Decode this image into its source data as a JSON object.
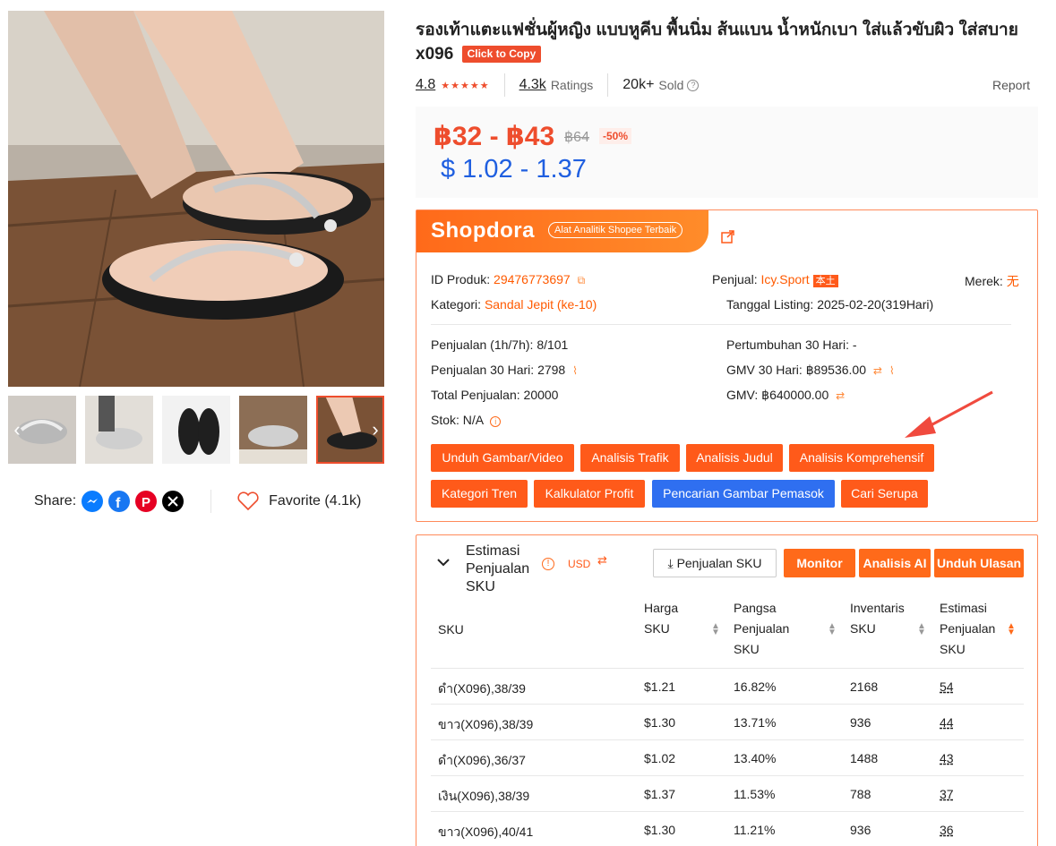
{
  "gallery": {
    "share_label": "Share:",
    "favorite_label": "Favorite (4.1k)",
    "thumbnail_count": 5,
    "active_thumbnail": 5
  },
  "product": {
    "title": "รองเท้าแตะแฟชั่นผู้หญิง แบบหูคีบ พื้นนิ่ม ส้นแบน น้ำหนักเบา ใส่แล้วขับผิว ใส่สบาย x096",
    "copy_label": "Click to Copy",
    "rating": "4.8",
    "rating_stars": 5,
    "ratings_count": "4.3k",
    "ratings_label": "Ratings",
    "sold_count": "20k+",
    "sold_label": "Sold",
    "report_label": "Report"
  },
  "price": {
    "range": "฿32 - ฿43",
    "original": "฿64",
    "discount": "-50%",
    "usd_range": "$ 1.02 - 1.37"
  },
  "shopdora": {
    "brand": "Shopdora",
    "tagline": "Alat Analitik Shopee Terbaik",
    "product_id_label": "ID Produk:",
    "product_id": "29476773697",
    "seller_label": "Penjual:",
    "seller": "Icy.Sport",
    "seller_badge": "本土",
    "brand_label": "Merek:",
    "brand_value": "无",
    "category_label": "Kategori:",
    "category": "Sandal Jepit (ke-10)",
    "listing_label": "Tanggal Listing:",
    "listing_value": "2025-02-20(319Hari)",
    "sales_1h7h_label": "Penjualan (1h/7h):",
    "sales_1h7h": "8/101",
    "growth_label": "Pertumbuhan 30 Hari:",
    "growth": "-",
    "sales_30d_label": "Penjualan 30 Hari:",
    "sales_30d": "2798",
    "gmv_30d_label": "GMV 30 Hari:",
    "gmv_30d": "฿89536.00",
    "total_sales_label": "Total Penjualan:",
    "total_sales": "20000",
    "gmv_label": "GMV:",
    "gmv": "฿640000.00",
    "stock_label": "Stok:",
    "stock": "N/A",
    "buttons": [
      "Unduh Gambar/Video",
      "Analisis Trafik",
      "Analisis Judul",
      "Analisis Komprehensif",
      "Kategori Tren",
      "Kalkulator Profit",
      "Pencarian Gambar Pemasok",
      "Cari Serupa"
    ]
  },
  "sku": {
    "title": "Estimasi Penjualan SKU",
    "currency": "USD",
    "download_label": "Penjualan SKU",
    "monitor_label": "Monitor",
    "ai_label": "Analisis AI",
    "reviews_label": "Unduh Ulasan",
    "headers": [
      "SKU",
      "Harga SKU",
      "Pangsa Penjualan SKU",
      "Inventaris SKU",
      "Estimasi Penjualan SKU"
    ],
    "rows": [
      [
        "ดำ(X096),38/39",
        "$1.21",
        "16.82%",
        "2168",
        "54"
      ],
      [
        "ขาว(X096),38/39",
        "$1.30",
        "13.71%",
        "936",
        "44"
      ],
      [
        "ดำ(X096),36/37",
        "$1.02",
        "13.40%",
        "1488",
        "43"
      ],
      [
        "เงิน(X096),38/39",
        "$1.37",
        "11.53%",
        "788",
        "37"
      ],
      [
        "ขาว(X096),40/41",
        "$1.30",
        "11.21%",
        "936",
        "36"
      ]
    ]
  },
  "colors": {
    "shopee_orange": "#ee4d2d",
    "shopdora_orange": "#ff5a1a",
    "usd_blue": "#1f5fe0",
    "button_blue": "#2f6ff0"
  }
}
